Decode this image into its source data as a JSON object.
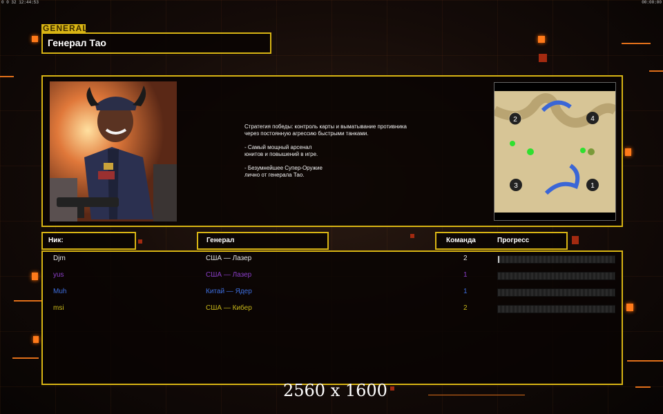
{
  "status_bar": {
    "left": "0  0  32  12:44:53",
    "right": "00:00:00"
  },
  "header": {
    "tag": "GENERAL",
    "title": "Генерал Тао"
  },
  "description": "Стратегия победы: контроль карты и выматывание противника\n через постоянную агрессию быстрыми танками.\n\n- Самый мощный арсенал\nюнитов и повышений в игре.\n\n- Безумнейшее Супер-Оружие\nлично от генерала Тао.",
  "minimap": {
    "start_positions": [
      "1",
      "2",
      "3",
      "4"
    ]
  },
  "columns": {
    "nick": "Ник:",
    "general": "Генерал",
    "team": "Команда",
    "progress": "Прогресс"
  },
  "players": [
    {
      "nick": "Djm",
      "general": "США — Лазер",
      "team": "2",
      "color": "#e6e6e6",
      "progress": 0.01
    },
    {
      "nick": "yus",
      "general": "США — Лазер",
      "team": "1",
      "color": "#8a3ec8",
      "progress": 0
    },
    {
      "nick": "Muh",
      "general": "Китай — Ядер",
      "team": "1",
      "color": "#3e6fe0",
      "progress": 0
    },
    {
      "nick": "msi",
      "general": "США — Кибер",
      "team": "2",
      "color": "#c9b81a",
      "progress": 0
    }
  ],
  "resolution_watermark": "2560 x 1600"
}
